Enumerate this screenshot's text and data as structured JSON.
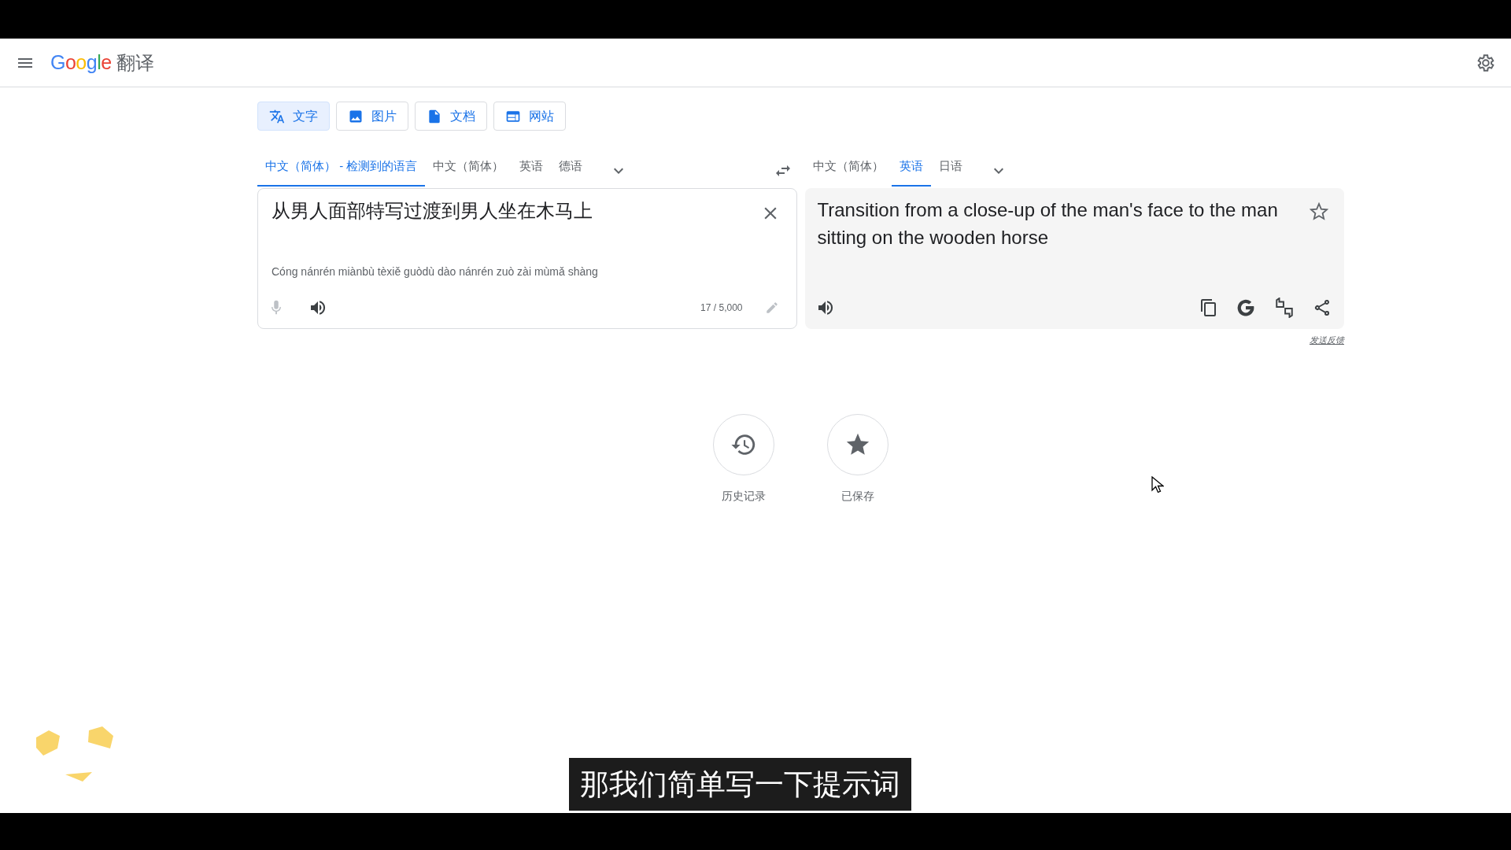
{
  "header": {
    "logo": "Google",
    "app_name": "翻译"
  },
  "modes": [
    {
      "label": "文字",
      "selected": true
    },
    {
      "label": "图片",
      "selected": false
    },
    {
      "label": "文档",
      "selected": false
    },
    {
      "label": "网站",
      "selected": false
    }
  ],
  "source_languages": [
    {
      "label": "中文（简体） - 检测到的语言",
      "selected": true
    },
    {
      "label": "中文（简体）",
      "selected": false
    },
    {
      "label": "英语",
      "selected": false
    },
    {
      "label": "德语",
      "selected": false
    }
  ],
  "target_languages": [
    {
      "label": "中文（简体）",
      "selected": false
    },
    {
      "label": "英语",
      "selected": true
    },
    {
      "label": "日语",
      "selected": false
    }
  ],
  "source": {
    "text": "从男人面部特写过渡到男人坐在木马上",
    "romanization": "Cóng nánrén miànbù tèxiě guòdù dào nánrén zuò zài mùmǎ shàng",
    "char_count": "17 / 5,000"
  },
  "target": {
    "text": "Transition from a close-up of the man's face to the man sitting on the wooden horse"
  },
  "feedback": "发送反馈",
  "shortcuts": [
    {
      "label": "历史记录"
    },
    {
      "label": "已保存"
    }
  ],
  "subtitle": "那我们简单写一下提示词"
}
